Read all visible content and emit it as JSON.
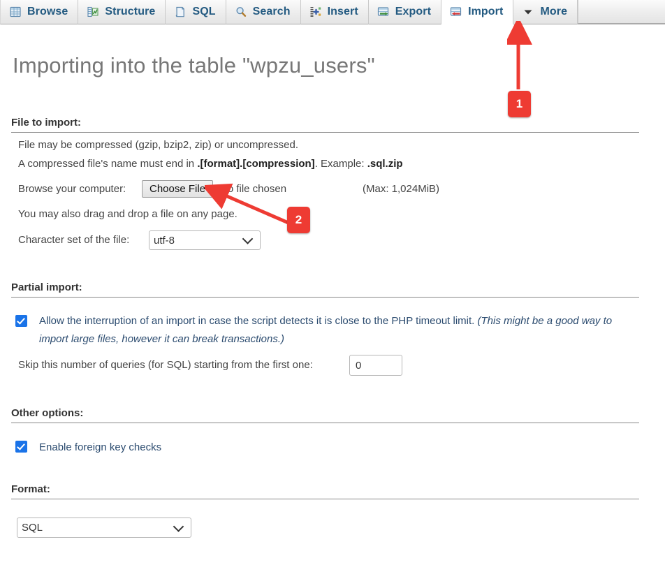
{
  "tabs": [
    {
      "label": "Browse",
      "icon": "table-grid-icon",
      "active": false
    },
    {
      "label": "Structure",
      "icon": "structure-icon",
      "active": false
    },
    {
      "label": "SQL",
      "icon": "document-sql-icon",
      "active": false
    },
    {
      "label": "Search",
      "icon": "magnifier-icon",
      "active": false
    },
    {
      "label": "Insert",
      "icon": "insert-row-icon",
      "active": false
    },
    {
      "label": "Export",
      "icon": "export-arrow-icon",
      "active": false
    },
    {
      "label": "Import",
      "icon": "import-arrow-icon",
      "active": true
    },
    {
      "label": "More",
      "icon": "chevron-down-icon",
      "active": false
    }
  ],
  "page": {
    "title": "Importing into the table \"wpzu_users\""
  },
  "file_to_import": {
    "heading": "File to import:",
    "line1": "File may be compressed (gzip, bzip2, zip) or uncompressed.",
    "line2_prefix": "A compressed file's name must end in ",
    "line2_bold": ".[format].[compression]",
    "line2_mid": ". Example: ",
    "line2_bold2": ".sql.zip",
    "browse_label": "Browse your computer:",
    "choose_file_button": "Choose File",
    "no_file_chosen": "No file chosen",
    "max_size": "(Max: 1,024MiB)",
    "drag_drop_hint": "You may also drag and drop a file on any page.",
    "charset_label": "Character set of the file:",
    "charset_value": "utf-8",
    "charset_options": [
      "utf-8"
    ]
  },
  "partial_import": {
    "heading": "Partial import:",
    "allow_interrupt_checked": true,
    "allow_interrupt_text": "Allow the interruption of an import in case the script detects it is close to the PHP timeout limit.",
    "allow_interrupt_italic": "(This might be a good way to import large files, however it can break transactions.)",
    "skip_label": "Skip this number of queries (for SQL) starting from the first one:",
    "skip_value": "0"
  },
  "other_options": {
    "heading": "Other options:",
    "foreign_key_checked": true,
    "foreign_key_label": "Enable foreign key checks"
  },
  "format": {
    "heading": "Format:",
    "value": "SQL",
    "options": [
      "SQL"
    ]
  },
  "annotations": [
    {
      "number": "1",
      "target": "import-tab"
    },
    {
      "number": "2",
      "target": "choose-file-button"
    }
  ],
  "colors": {
    "annotation_red": "#ee3b33",
    "tab_link_blue": "#235a81",
    "checkbox_blue": "#1a73e8",
    "title_gray": "#777777"
  }
}
